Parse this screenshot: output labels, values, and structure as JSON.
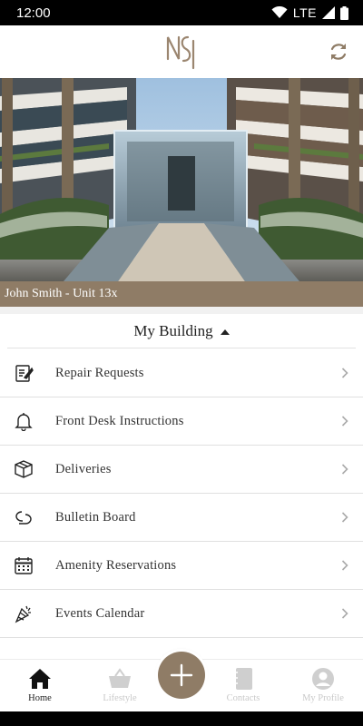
{
  "status_bar": {
    "time": "12:00",
    "network": "LTE"
  },
  "header": {
    "logo_icon": "nsi-monogram-logo",
    "refresh_icon": "refresh-icon"
  },
  "hero": {
    "image": "building-courtyard-photo"
  },
  "resident": {
    "label": "John Smith - Unit 13x"
  },
  "section": {
    "title": "My Building"
  },
  "menu": {
    "items": [
      {
        "label": "Repair Requests",
        "icon": "repair-form-icon"
      },
      {
        "label": "Front Desk Instructions",
        "icon": "bell-icon"
      },
      {
        "label": "Deliveries",
        "icon": "package-icon"
      },
      {
        "label": "Bulletin Board",
        "icon": "chat-bubbles-icon"
      },
      {
        "label": "Amenity Reservations",
        "icon": "calendar-icon"
      },
      {
        "label": "Events Calendar",
        "icon": "party-icon"
      }
    ]
  },
  "bottom_nav": {
    "items": [
      {
        "label": "Home",
        "icon": "home-icon",
        "active": true
      },
      {
        "label": "Lifestyle",
        "icon": "basket-icon",
        "active": false
      },
      {
        "label": "Contacts",
        "icon": "address-book-icon",
        "active": false
      },
      {
        "label": "My Profile",
        "icon": "profile-icon",
        "active": false
      }
    ],
    "fab_icon": "plus-icon"
  },
  "colors": {
    "accent": "#8f7c66",
    "inactive": "#c9c9c9"
  }
}
